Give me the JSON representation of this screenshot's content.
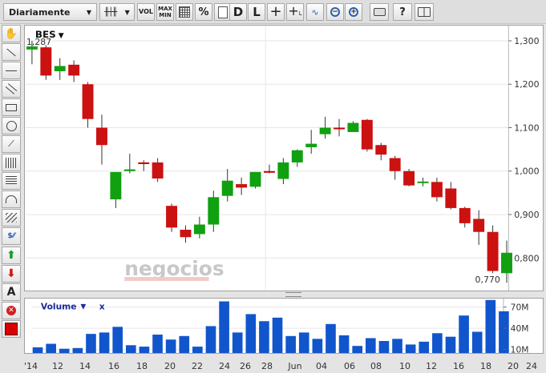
{
  "toolbar": {
    "period": "Diariamente",
    "vol_label": "VOL",
    "maxmin_line1": "MAX",
    "maxmin_line2": "MIN",
    "percent_label": "%",
    "daily_label": "D",
    "log_label": "L"
  },
  "chart_data": [
    {
      "type": "candlestick",
      "title": "BES",
      "ylim": [
        0.725,
        1.335
      ],
      "y_ticks": [
        0.8,
        0.9,
        1.0,
        1.1,
        1.2,
        1.3
      ],
      "y_tick_labels": [
        "0,800",
        "0,900",
        "1,000",
        "1,100",
        "1,200",
        "1,300"
      ],
      "annotations": {
        "high_label": "1,287",
        "low_label": "0,770"
      },
      "watermark": "negocios",
      "grid": true,
      "x_tick_labels": [
        "'14",
        "12",
        "14",
        "16",
        "18",
        "20",
        "22",
        "24",
        "26",
        "28",
        "Jun",
        "04",
        "06",
        "08",
        "10",
        "12",
        "16",
        "18",
        "20",
        "24"
      ],
      "ohlc": [
        [
          1.28,
          1.3,
          1.246,
          1.287
        ],
        [
          1.285,
          1.29,
          1.21,
          1.22
        ],
        [
          1.23,
          1.26,
          1.21,
          1.242
        ],
        [
          1.245,
          1.255,
          1.205,
          1.22
        ],
        [
          1.2,
          1.205,
          1.1,
          1.12
        ],
        [
          1.1,
          1.13,
          1.015,
          1.06
        ],
        [
          0.935,
          0.99,
          0.915,
          0.998
        ],
        [
          1.0,
          1.04,
          0.995,
          1.004
        ],
        [
          1.02,
          1.025,
          1.0,
          1.02
        ],
        [
          1.02,
          1.03,
          0.975,
          0.983
        ],
        [
          0.92,
          0.925,
          0.86,
          0.87
        ],
        [
          0.865,
          0.875,
          0.835,
          0.848
        ],
        [
          0.855,
          0.895,
          0.845,
          0.877
        ],
        [
          0.877,
          0.955,
          0.86,
          0.94
        ],
        [
          0.943,
          1.005,
          0.93,
          0.978
        ],
        [
          0.97,
          0.985,
          0.945,
          0.962
        ],
        [
          0.964,
          0.998,
          0.96,
          0.998
        ],
        [
          1.0,
          1.015,
          0.995,
          1.0
        ],
        [
          0.982,
          1.03,
          0.97,
          1.02
        ],
        [
          1.02,
          1.05,
          1.01,
          1.048
        ],
        [
          1.055,
          1.095,
          1.04,
          1.063
        ],
        [
          1.085,
          1.125,
          1.075,
          1.1
        ],
        [
          1.1,
          1.12,
          1.08,
          1.1
        ],
        [
          1.09,
          1.115,
          1.09,
          1.111
        ],
        [
          1.118,
          1.12,
          1.045,
          1.05
        ],
        [
          1.06,
          1.065,
          1.025,
          1.038
        ],
        [
          1.03,
          1.035,
          0.98,
          1.0
        ],
        [
          1.0,
          1.005,
          0.965,
          0.967
        ],
        [
          0.975,
          0.985,
          0.965,
          0.976
        ],
        [
          0.975,
          0.985,
          0.93,
          0.94
        ],
        [
          0.96,
          0.975,
          0.912,
          0.915
        ],
        [
          0.915,
          0.918,
          0.87,
          0.88
        ],
        [
          0.89,
          0.91,
          0.83,
          0.86
        ],
        [
          0.86,
          0.875,
          0.765,
          0.77
        ],
        [
          0.765,
          0.84,
          0.743,
          0.812
        ]
      ]
    },
    {
      "type": "bar",
      "title": "Volume",
      "ylim": [
        5,
        82
      ],
      "y_ticks": [
        10,
        40,
        70
      ],
      "y_tick_labels": [
        "10M",
        "40M",
        "70M"
      ],
      "values": [
        13,
        18,
        11,
        12,
        32,
        34,
        42,
        16,
        14,
        31,
        24,
        29,
        14,
        43,
        78,
        34,
        60,
        50,
        55,
        29,
        34,
        25,
        46,
        30,
        15,
        26,
        22,
        25,
        17,
        21,
        33,
        28,
        58,
        35,
        80,
        64
      ]
    }
  ]
}
